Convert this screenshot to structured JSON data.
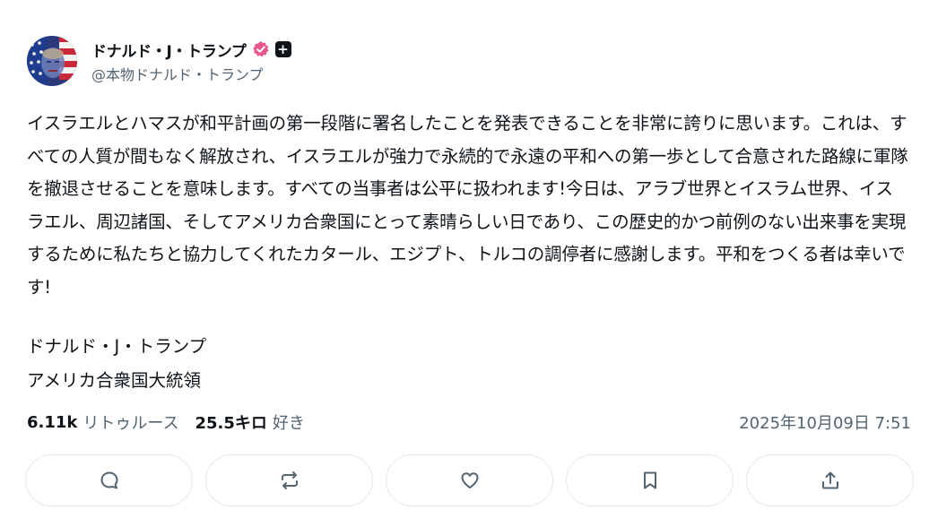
{
  "author": {
    "display_name": "ドナルド・J・トランプ",
    "handle": "@本物ドナルド・トランプ",
    "verified_badge_color": "#e8578f",
    "avatar_icon": "flag-portrait-avatar"
  },
  "post": {
    "body": "イスラエルとハマスが和平計画の第一段階に署名したことを発表できることを非常に誇りに思います。これは、すべての人質が間もなく解放され、イスラエルが強力で永続的で永遠の平和への第一歩として合意された路線に軍隊を撤退させることを意味します。すべての当事者は公平に扱われます!今日は、アラブ世界とイスラム世界、イスラエル、周辺諸国、そしてアメリカ合衆国にとって素晴らしい日であり、この歴史的かつ前例のない出来事を実現するために私たちと協力してくれたカタール、エジプト、トルコの調停者に感謝します。平和をつくる者は幸いです!",
    "signature_name": "ドナルド・J・トランプ",
    "signature_title": "アメリカ合衆国大統領"
  },
  "stats": {
    "retweets_count": "6.11k",
    "retweets_label": "リトゥルース",
    "likes_count": "25.5キロ",
    "likes_label": "好き",
    "timestamp": "2025年10月09日 7:51"
  },
  "actions": [
    {
      "icon": "reply-icon"
    },
    {
      "icon": "retruth-icon"
    },
    {
      "icon": "like-icon"
    },
    {
      "icon": "bookmark-icon"
    },
    {
      "icon": "share-icon"
    }
  ]
}
